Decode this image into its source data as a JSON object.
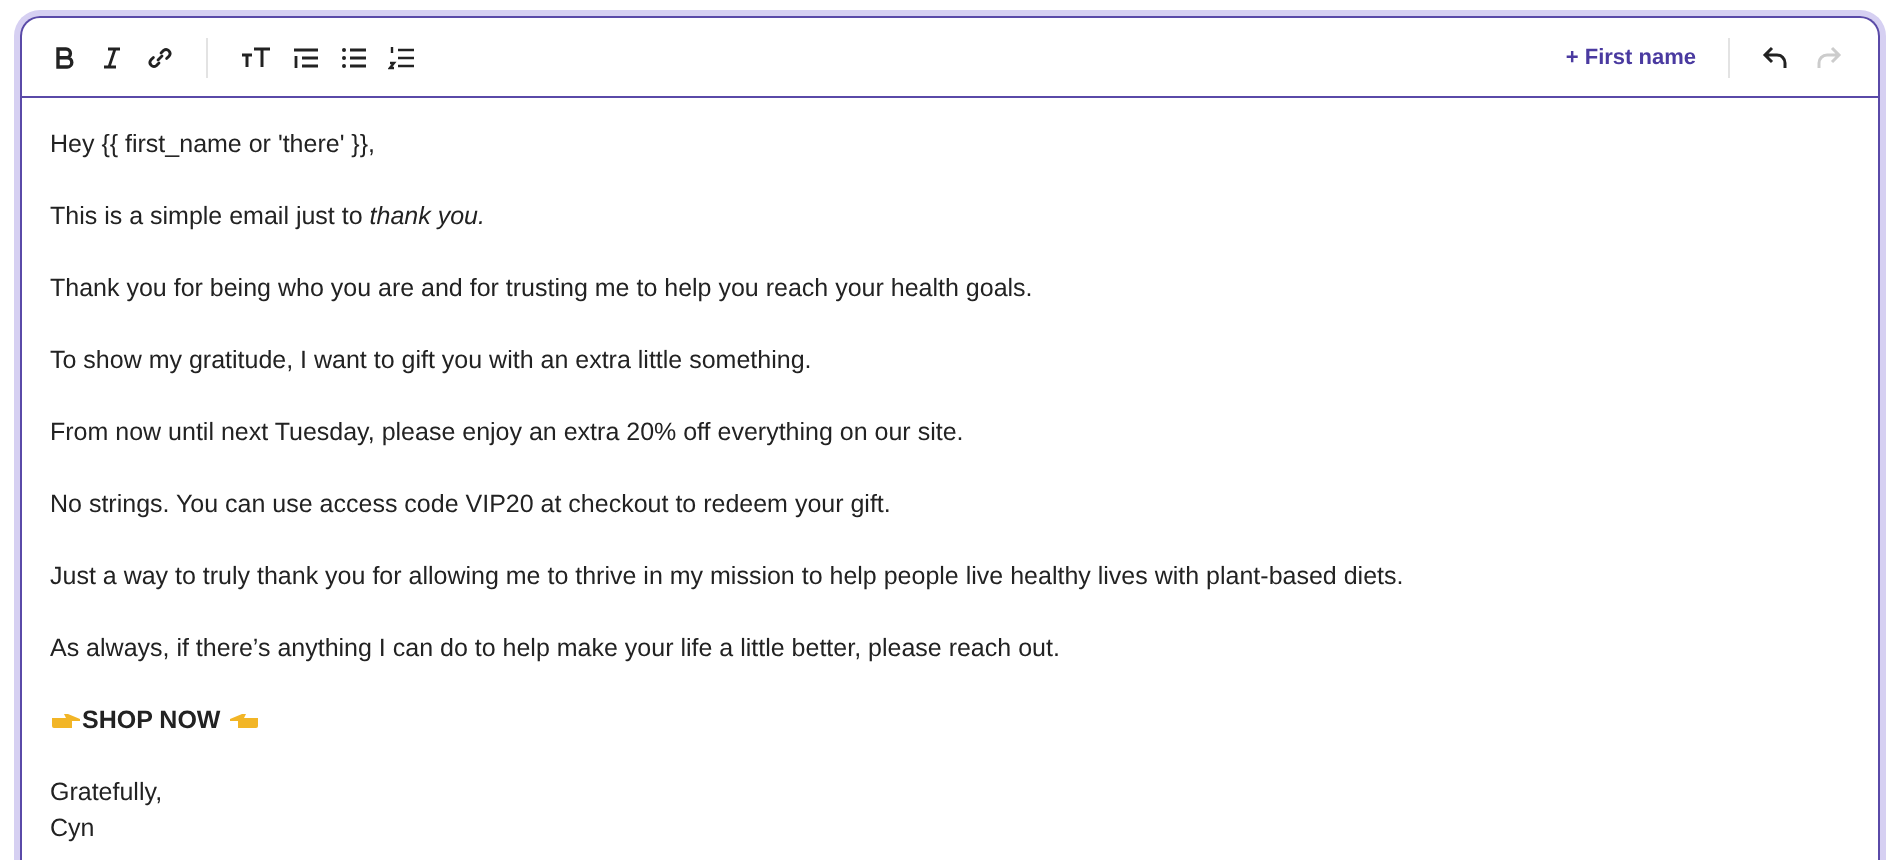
{
  "toolbar": {
    "insert_button": "+ First name",
    "undo": {
      "disabled": false
    },
    "redo": {
      "disabled": true
    }
  },
  "body": [
    {
      "kind": "text",
      "text": "Hey {{ first_name or 'there' }},"
    },
    {
      "kind": "text",
      "text": "This is a simple email just to *thank you.*"
    },
    {
      "kind": "text",
      "text": "Thank you for being who you are and for trusting me to help you reach your health goals."
    },
    {
      "kind": "text",
      "text": "To show my gratitude, I want to gift you with an extra little something."
    },
    {
      "kind": "text",
      "text": "From now until next Tuesday, please enjoy an extra 20% off everything on our site."
    },
    {
      "kind": "text",
      "text": "No strings. You can use access code VIP20 at checkout to redeem your gift."
    },
    {
      "kind": "text",
      "text": "Just a way to truly thank you for allowing me to thrive in my mission to help people live healthy lives with plant-based diets."
    },
    {
      "kind": "text",
      "text": "As always, if there’s anything I can do to help make your life a little better, please reach out."
    },
    {
      "kind": "cta",
      "text": "SHOP NOW"
    },
    {
      "kind": "lines",
      "lines": [
        "Gratefully,",
        "Cyn"
      ]
    }
  ]
}
